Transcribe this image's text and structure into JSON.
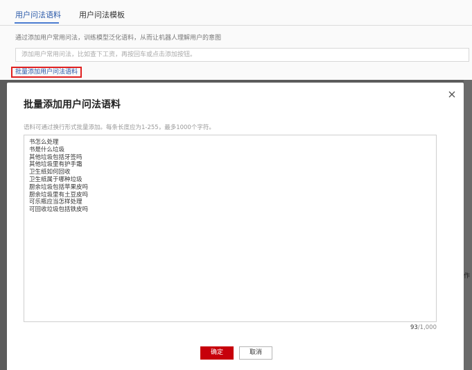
{
  "tabs": [
    {
      "label": "用户问法语料",
      "active": true
    },
    {
      "label": "用户问法模板",
      "active": false
    }
  ],
  "description": "通过添加用户常用问法，训练模型泛化语料，从而让机器人理解用户的意图",
  "input": {
    "placeholder": "添加用户常用问法，比如查下工资，再按回车或点击添加按钮。"
  },
  "batch_link_label": "批量添加用户问法语料",
  "right_edge_text": "作",
  "modal": {
    "title": "批量添加用户问法语料",
    "close_icon": "close-icon",
    "hint": "语料可通过换行形式批量添加。每条长度应为1-255，最多1000个字符。",
    "textarea_lines": [
      "书怎么处理",
      "书是什么垃圾",
      "其他垃圾包括牙签吗",
      "其他垃圾里有护手霜",
      "卫生纸如何回收",
      "卫生纸属于哪种垃圾",
      "厨余垃圾包括苹果皮吗",
      "厨余垃圾里有土豆皮吗",
      "可乐瓶应当怎样处理",
      "可回收垃圾包括铁皮吗"
    ],
    "counter": {
      "current": "93",
      "max": "/1,000"
    },
    "confirm_label": "确定",
    "cancel_label": "取消"
  },
  "colors": {
    "accent": "#2b5aa9",
    "primary_button": "#c7000b",
    "highlight_border": "#e02020",
    "overlay": "#5c5c5c"
  }
}
